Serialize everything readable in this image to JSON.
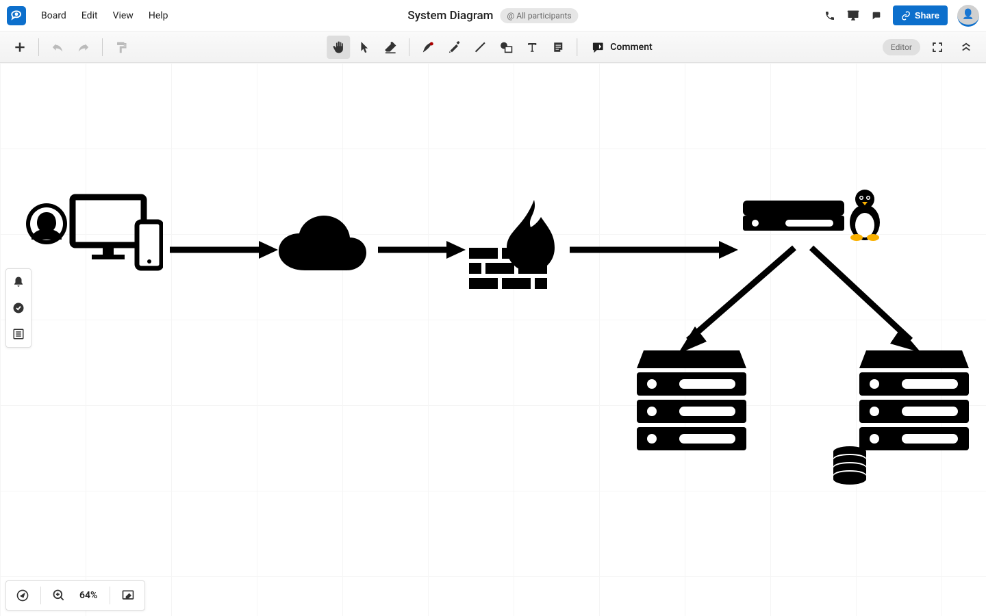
{
  "header": {
    "menus": [
      "Board",
      "Edit",
      "View",
      "Help"
    ],
    "title": "System Diagram",
    "participants": "@ All participants",
    "share_label": "Share"
  },
  "toolbar": {
    "comment_label": "Comment",
    "editor_pill": "Editor"
  },
  "bottom": {
    "zoom": "64%"
  },
  "diagram": {
    "nodes": [
      {
        "id": "user-devices",
        "label": "user devices"
      },
      {
        "id": "cloud",
        "label": "cloud"
      },
      {
        "id": "firewall",
        "label": "firewall"
      },
      {
        "id": "switch",
        "label": "switch (linux)"
      },
      {
        "id": "server-stack-left",
        "label": "server stack"
      },
      {
        "id": "server-stack-right",
        "label": "server stack with database"
      }
    ],
    "edges": [
      {
        "from": "user-devices",
        "to": "cloud"
      },
      {
        "from": "cloud",
        "to": "firewall"
      },
      {
        "from": "firewall",
        "to": "switch"
      },
      {
        "from": "switch",
        "to": "server-stack-left"
      },
      {
        "from": "switch",
        "to": "server-stack-right"
      }
    ]
  }
}
